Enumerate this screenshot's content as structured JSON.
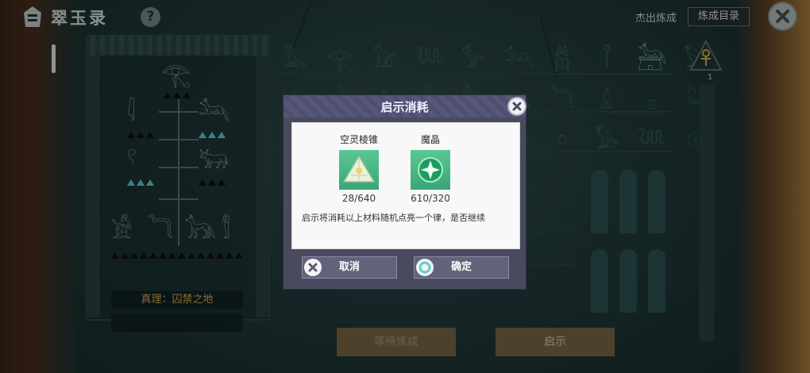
{
  "app": {
    "title": "翠玉录",
    "help_label": "?",
    "logo_icon": "pharaoh-head-icon"
  },
  "topbar": {
    "elite_label": "杰出炼成",
    "catalog_label": "炼成目录",
    "close_icon": "close-icon"
  },
  "left_panel": {
    "truth_label": "真理：囚禁之地"
  },
  "ankh": {
    "level": "1"
  },
  "bottom_buttons": {
    "wait_label": "等待炼成",
    "reveal_label": "启示"
  },
  "dialog": {
    "title": "启示消耗",
    "items": [
      {
        "name": "空灵棱锥",
        "count": "28/640",
        "icon": "pyramid-icon"
      },
      {
        "name": "魔晶",
        "count": "610/320",
        "icon": "magic-crystal-icon"
      }
    ],
    "description": "启示将消耗以上材料随机点亮一个律，是否继续",
    "cancel_label": "取消",
    "confirm_label": "确定"
  },
  "colors": {
    "wall": "#223b3b",
    "dialog_header": "#57577a",
    "dialog_button": "#62627a",
    "item_green": "#4fbf8a",
    "truth_gold": "#d8b25a",
    "bottom_button": "#7e6a47"
  }
}
